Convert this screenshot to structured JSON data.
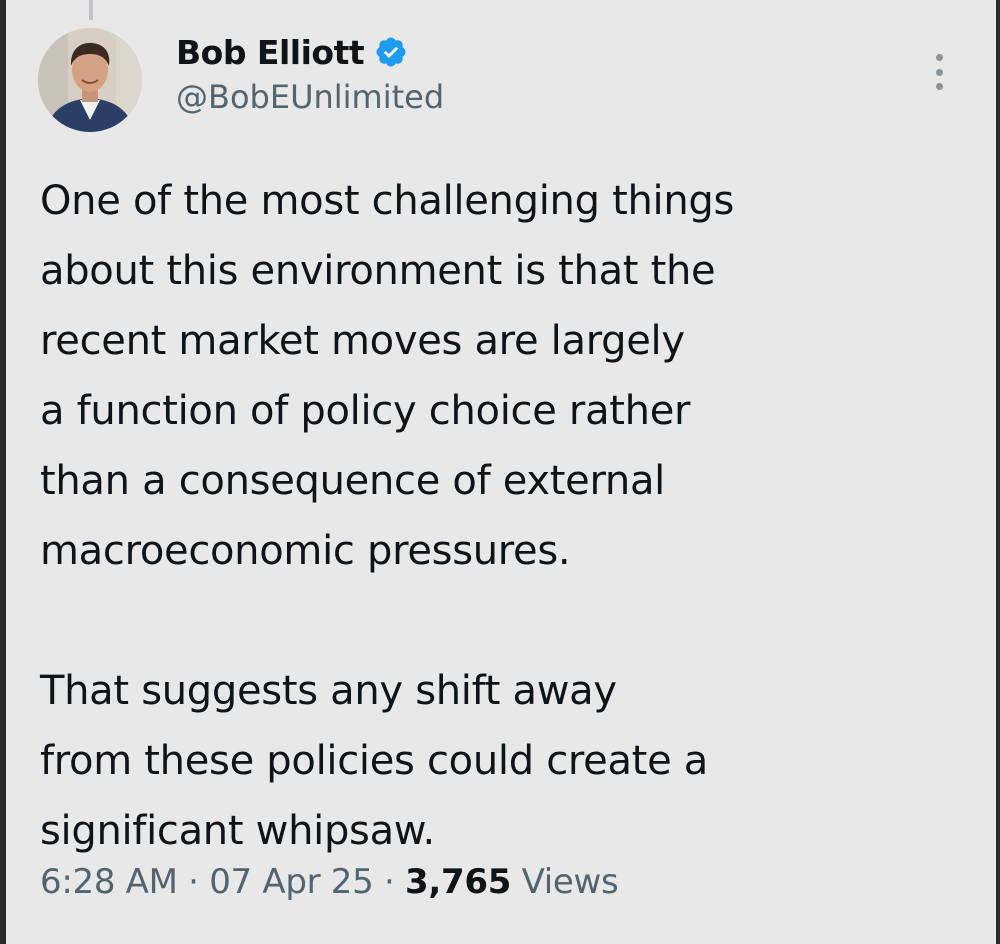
{
  "author": {
    "display_name": "Bob Elliott",
    "handle": "@BobEUnlimited",
    "verified": true,
    "verified_color": "#1d9bf0"
  },
  "tweet": {
    "paragraph1_lines": [
      "One of the most challenging things",
      "about this environment is that the",
      "recent market moves are largely",
      "a function of policy choice rather",
      "than a consequence of external",
      "macroeconomic pressures."
    ],
    "paragraph2_lines": [
      "That suggests any shift away",
      "from these policies could create a",
      "significant whipsaw."
    ]
  },
  "meta": {
    "time": "6:28 AM",
    "separator": "·",
    "date": "07 Apr 25",
    "views_count": "3,765",
    "views_label": "Views"
  },
  "icons": {
    "avatar": "profile-photo",
    "verified": "verified-badge-icon",
    "more": "more-options-icon"
  }
}
